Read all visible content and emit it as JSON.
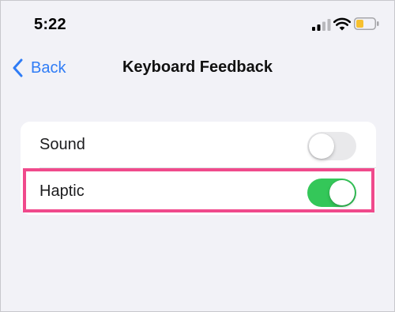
{
  "status_bar": {
    "time": "5:22",
    "icons": [
      "cellular-signal-icon",
      "wifi-icon",
      "battery-icon"
    ],
    "battery_color": "#f7c02e"
  },
  "nav": {
    "back_label": "Back",
    "title": "Keyboard Feedback"
  },
  "settings": {
    "rows": [
      {
        "label": "Sound",
        "enabled": false
      },
      {
        "label": "Haptic",
        "enabled": true
      }
    ]
  },
  "colors": {
    "accent_blue": "#2f7cf6",
    "toggle_on": "#34c759",
    "toggle_off": "#e9e9eb",
    "highlight": "#f04a8c",
    "background": "#f2f2f7"
  }
}
